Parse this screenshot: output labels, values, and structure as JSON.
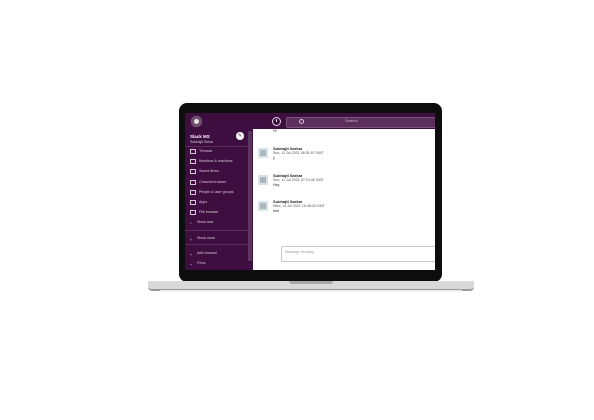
{
  "app": {
    "search_placeholder": "Search"
  },
  "workspace": {
    "name": "Slack MS",
    "user": "Subhajit Sirkar"
  },
  "sidebar": {
    "items": [
      {
        "label": "Threads",
        "icon": "threads-icon"
      },
      {
        "label": "Mentions & reactions",
        "icon": "mentions-icon"
      },
      {
        "label": "Saved items",
        "icon": "bookmark-icon"
      },
      {
        "label": "Channel browser",
        "icon": "channel-icon"
      },
      {
        "label": "People & user groups",
        "icon": "people-icon"
      },
      {
        "label": "Apps",
        "icon": "apps-icon"
      },
      {
        "label": "File browser",
        "icon": "file-icon"
      },
      {
        "label": "Show less",
        "icon": "chevron-up-icon"
      }
    ],
    "show_more": "Show more",
    "add_channel": "Add channel",
    "dms": "Films"
  },
  "messages": [
    {
      "name": "",
      "time": "",
      "text": "Hi"
    },
    {
      "name": "Subhajit Sarkar",
      "time": "Sun, 11 Jul 2021 06:51:57 GMT",
      "text": "ji"
    },
    {
      "name": "Subhajit Sarkar",
      "time": "Sun, 11 Jul 2021 07:14:46 GMT",
      "text": "Hey"
    },
    {
      "name": "Subhajit Sarkar",
      "time": "Wed, 14 Jul 2021 15:48:43 GMT",
      "text": "heh"
    }
  ],
  "composer": {
    "placeholder": "Message trending"
  },
  "colors": {
    "sidebar": "#3f0e40",
    "laptop_bezel": "#0d0d0d",
    "laptop_base": "#d9d9d9"
  }
}
